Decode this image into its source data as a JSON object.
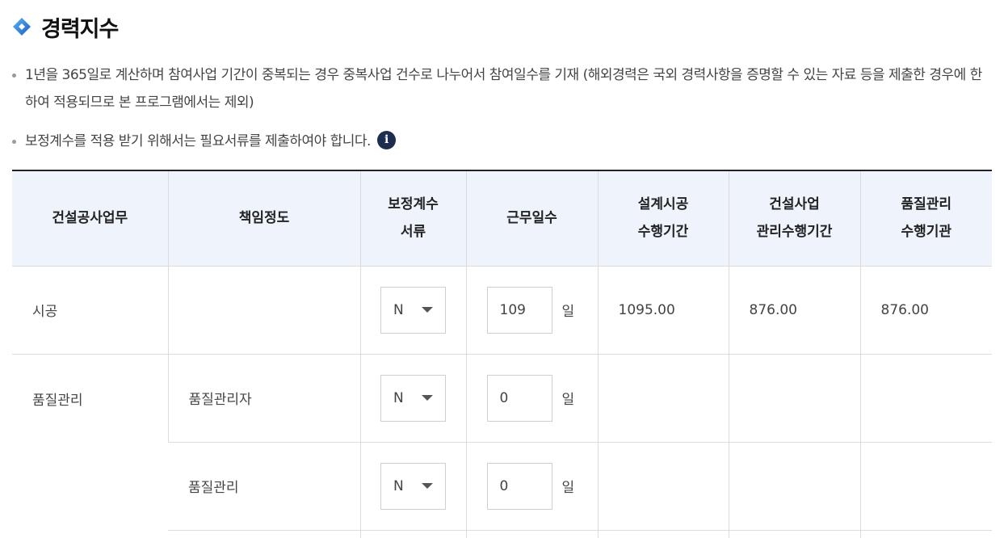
{
  "page": {
    "title": "경력지수",
    "title_icon": "diamond-icon"
  },
  "notes": [
    "1년을 365일로 계산하며 참여사업 기간이 중복되는 경우 중복사업 건수로 나누어서 참여일수를 기재 (해외경력은 국외 경력사항을 증명할 수 있는 자료 등을 제출한 경우에 한하여 적용되므로 본 프로그램에서는 제외)",
    "보정계수를 적용 받기 위해서는 필요서류를 제출하여야 합니다."
  ],
  "info_icon": {
    "glyph": "i",
    "color": "#1d2d50"
  },
  "table": {
    "headers": {
      "col1": "건설공사업무",
      "col2": "책임정도",
      "col3_line1": "보정계수",
      "col3_line2": "서류",
      "col4": "근무일수",
      "col5_line1": "설계시공",
      "col5_line2": "수행기간",
      "col6_line1": "건설사업",
      "col6_line2": "관리수행기간",
      "col7_line1": "품질관리",
      "col7_line2": "수행기관"
    },
    "day_unit": "일",
    "rows": [
      {
        "work": "시공",
        "responsibility": "",
        "doc": "N",
        "days": "109",
        "design_period": "1095.00",
        "cm_period": "876.00",
        "qc_period": "876.00"
      },
      {
        "work": "품질관리",
        "responsibility": "품질관리자",
        "doc": "N",
        "days": "0"
      },
      {
        "responsibility": "품질관리",
        "doc": "N",
        "days": "0"
      }
    ]
  },
  "colors": {
    "header_bg": "#eef3fc",
    "icon_blue": "#1a5cc8",
    "icon_light": "#5fb6f0"
  }
}
